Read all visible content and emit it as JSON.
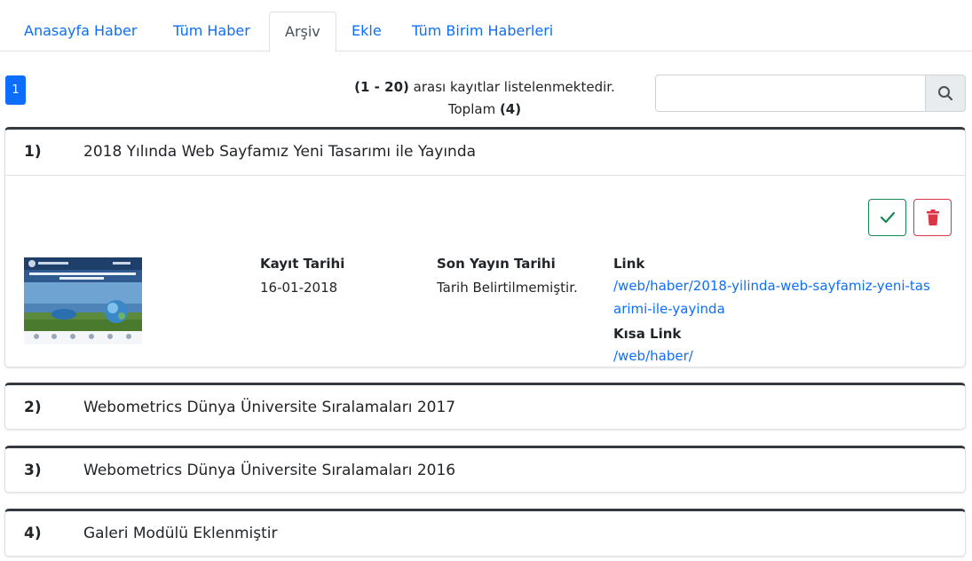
{
  "tabs": [
    {
      "label": "Anasayfa Haber"
    },
    {
      "label": "Tüm Haber"
    },
    {
      "label": "Arşiv"
    },
    {
      "label": "Ekle"
    },
    {
      "label": "Tüm Birim Haberleri"
    }
  ],
  "pagination": {
    "current_page": "1"
  },
  "records": {
    "range": "(1 - 20)",
    "range_suffix": " arası kayıtlar listelenmektedir.",
    "total_prefix": "Toplam ",
    "total": "(4)"
  },
  "search": {
    "placeholder": "",
    "value": ""
  },
  "items": [
    {
      "number": "1)",
      "title": "2018 Yılında Web Sayfamız Yeni Tasarımı ile Yayında",
      "details": {
        "kayit_label": "Kayıt Tarihi",
        "kayit_value": "16-01-2018",
        "yayin_label": "Son Yayın Tarihi",
        "yayin_value": "Tarih Belirtilmemiştir.",
        "link_label": "Link",
        "link_value": "/web/haber/2018-yilinda-web-sayfamiz-yeni-tasarimi-ile-yayinda",
        "short_label": "Kısa Link",
        "short_value": "/web/haber/"
      }
    },
    {
      "number": "2)",
      "title": "Webometrics Dünya Üniversite Sıralamaları 2017"
    },
    {
      "number": "3)",
      "title": "Webometrics Dünya Üniversite Sıralamaları 2016"
    },
    {
      "number": "4)",
      "title": "Galeri Modülü Eklenmiştir"
    }
  ],
  "colors": {
    "primary": "#0d6efd",
    "success": "#198754",
    "danger": "#dc3545",
    "card_top_border": "#343a40"
  },
  "icons": {
    "search": "search-icon",
    "approve": "check-icon",
    "delete": "trash-icon"
  }
}
